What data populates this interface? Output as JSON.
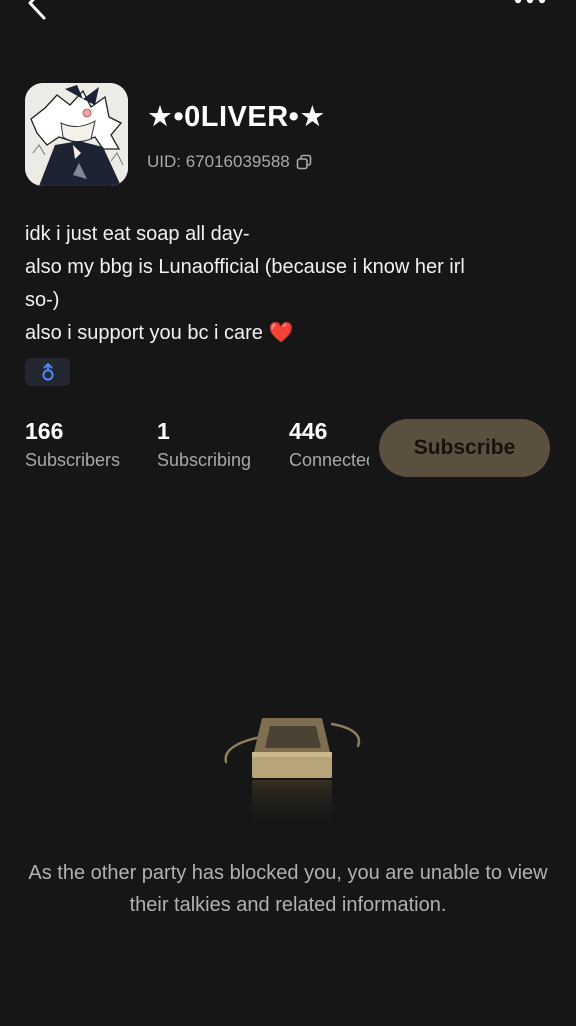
{
  "header": {
    "back_icon": "chevron-left-icon",
    "more_icon": "more-dots-icon"
  },
  "profile": {
    "name": "★•0LIVER•★",
    "uid": "UID: 67016039588",
    "copy_icon": "copy-icon",
    "bio_lines": [
      "idk i just eat soap all day-",
      "also my bbg is Lunaofficial (because i know her irl",
      "so-)",
      "also i support you bc i care ❤️"
    ],
    "badge_icon": "gender-symbol-icon"
  },
  "stats": [
    {
      "value": "166",
      "label": "Subscribers"
    },
    {
      "value": "1",
      "label": "Subscribing"
    },
    {
      "value": "446",
      "label": "Connected"
    }
  ],
  "subscribe_label": "Subscribe",
  "blocked_message": "As the other party has blocked you, you are unable to view their talkies and related information.",
  "colors": {
    "background": "#161616",
    "subscribe_button": "#5b5040",
    "illustration_gold": "#b7a478",
    "badge_blue": "#4f86ff"
  }
}
